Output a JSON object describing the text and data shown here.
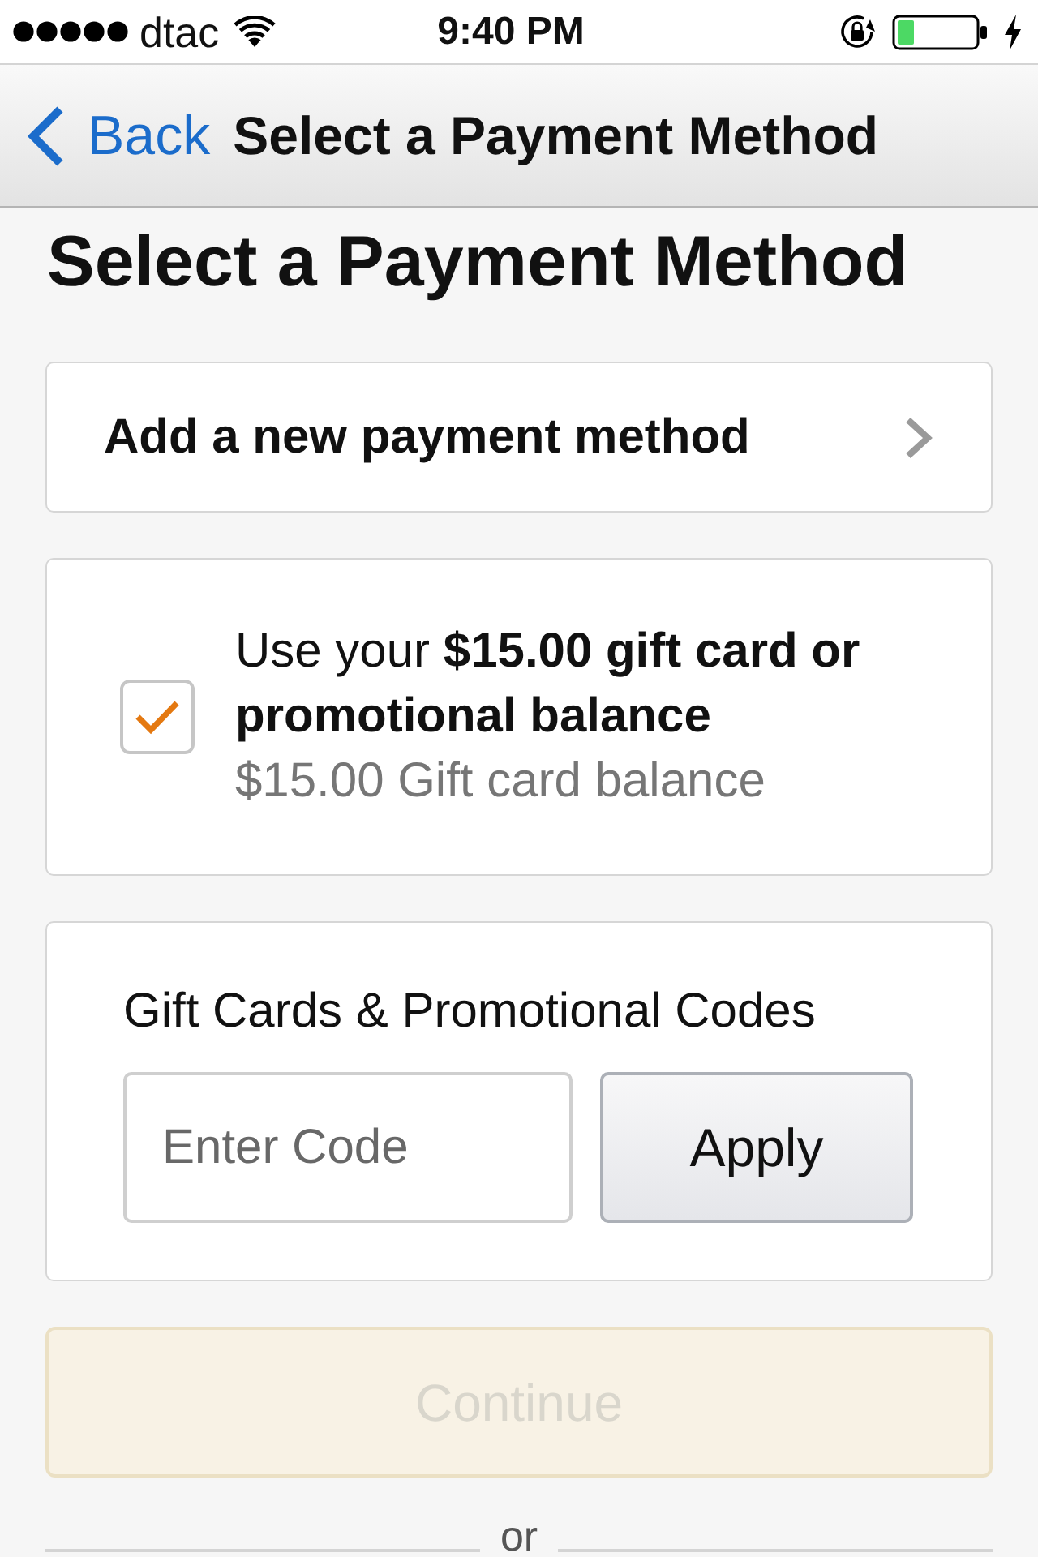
{
  "status_bar": {
    "carrier": "dtac",
    "time": "9:40 PM"
  },
  "nav_bar": {
    "back_label": "Back",
    "title": "Select a Payment Method"
  },
  "heading": "Select a Payment Method",
  "add_method": {
    "label": "Add a new payment method"
  },
  "balance_option": {
    "checked": true,
    "label": "Use your **$15.00 gift card or promotional balance**",
    "detail": "$15.00 Gift card balance"
  },
  "promo": {
    "title": "Gift Cards & Promotional Codes",
    "code_field": {
      "placeholder": "Enter Code"
    },
    "apply_button": "Apply"
  },
  "continue_button": {
    "label": "Continue",
    "disabled": true
  },
  "separator": "or"
}
